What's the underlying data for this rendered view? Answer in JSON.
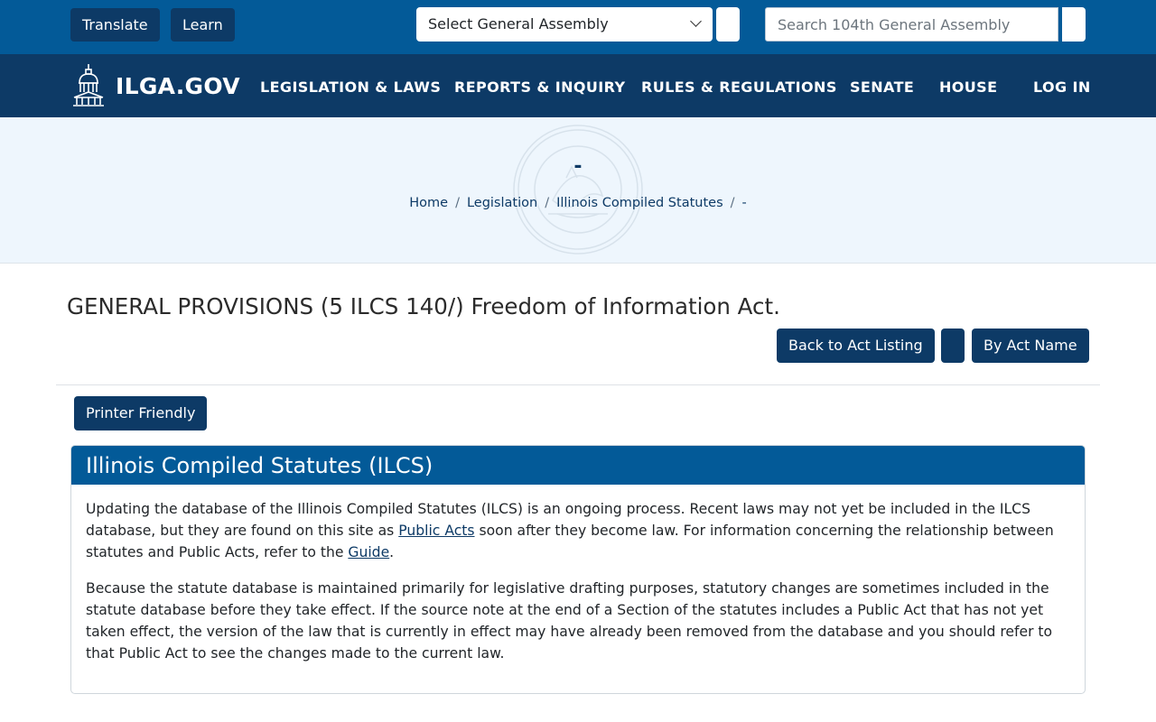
{
  "topbar": {
    "translate_label": "Translate",
    "learn_label": "Learn",
    "ga_select_value": "Select General Assembly",
    "search_placeholder": "Search 104th General Assembly"
  },
  "nav": {
    "logo_text": "ILGA.GOV",
    "items": [
      "LEGISLATION & LAWS",
      "REPORTS & INQUIRY",
      "RULES & REGULATIONS",
      "SENATE",
      "HOUSE"
    ],
    "login_label": "LOG IN"
  },
  "hero": {
    "title": "-",
    "breadcrumb": [
      "Home",
      "Legislation",
      "Illinois Compiled Statutes",
      "-"
    ]
  },
  "content": {
    "act_title": "GENERAL PROVISIONS (5 ILCS 140/) Freedom of Information Act.",
    "back_button": "Back to Act Listing",
    "by_act_name_button": "By Act Name",
    "printer_button": "Printer Friendly"
  },
  "notice": {
    "header": "Illinois Compiled Statutes (ILCS)",
    "p1_a": "Updating the database of the Illinois Compiled Statutes (ILCS) is an ongoing process. Recent laws may not yet be included in the ILCS database, but they are found on this site as ",
    "p1_link1": "Public Acts",
    "p1_b": " soon after they become law. For information concerning the relationship between statutes and Public Acts, refer to the ",
    "p1_link2": "Guide",
    "p1_c": ".",
    "p2": "Because the statute database is maintained primarily for legislative drafting purposes, statutory changes are sometimes included in the statute database before they take effect. If the source note at the end of a Section of the statutes includes a Public Act that has not yet taken effect, the version of the law that is currently in effect may have already been removed from the database and you should refer to that Public Act to see the changes made to the current law."
  },
  "colors": {
    "topbar": "#035a98",
    "navbar": "#0d3a66",
    "hero_bg": "#eef6fd",
    "button": "#0d3a66"
  }
}
